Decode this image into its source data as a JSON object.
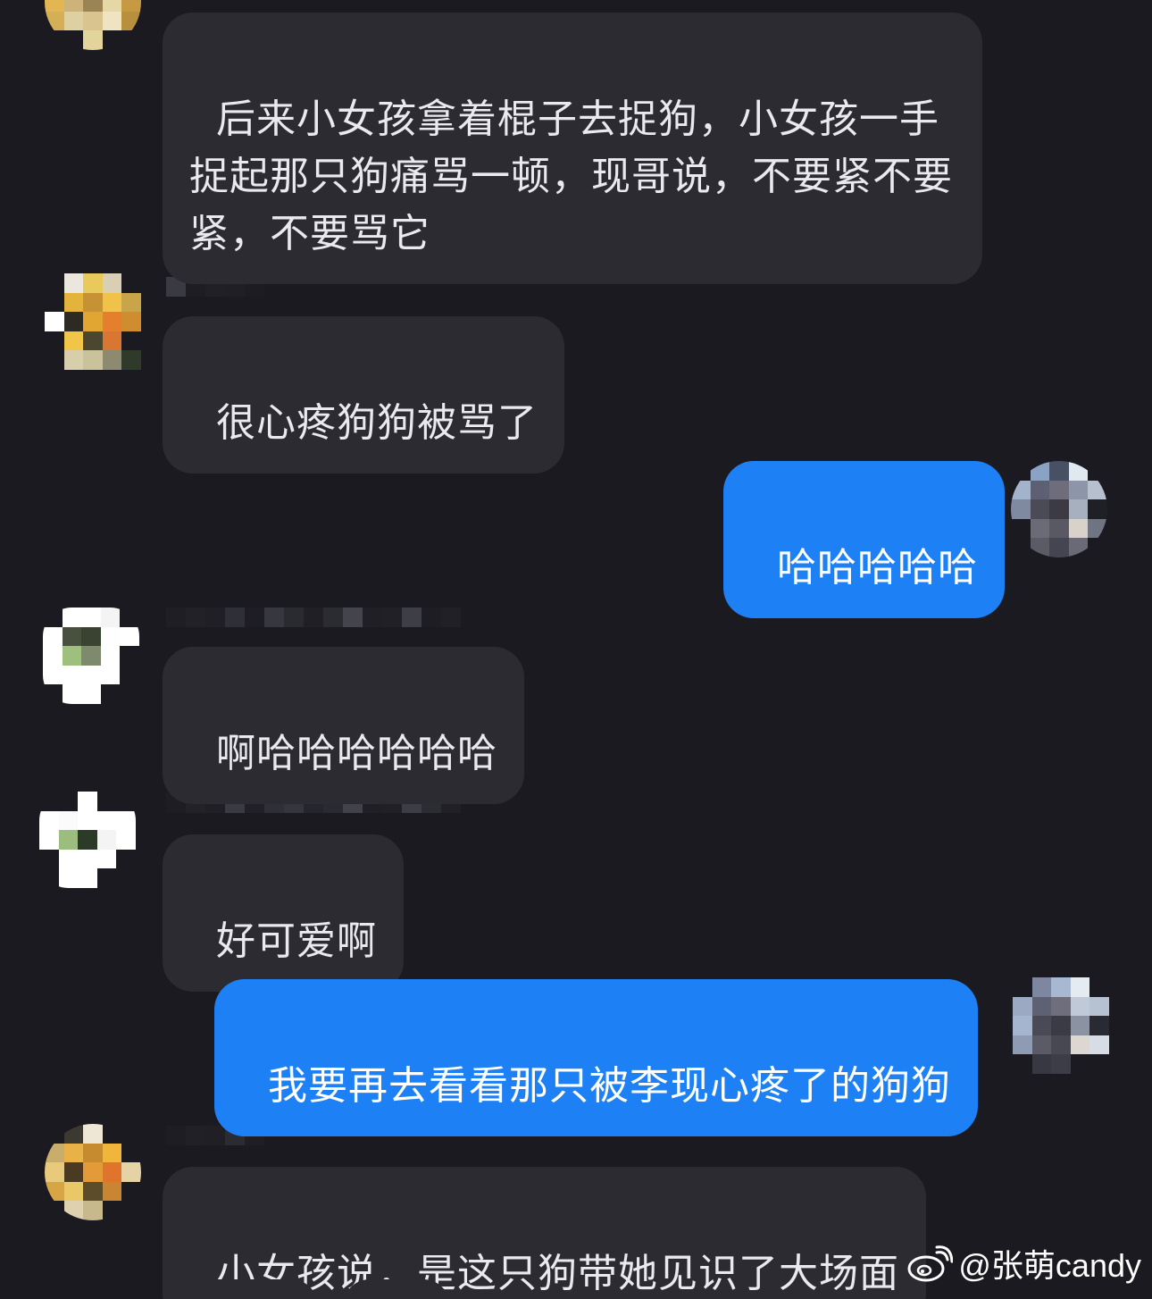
{
  "messages": [
    {
      "side": "in",
      "text": "后来小女孩拿着棍子去捉狗，小女孩一手捉起那只狗痛骂一顿，现哥说，不要紧不要紧，不要骂它"
    },
    {
      "side": "in",
      "text": "很心疼狗狗被骂了"
    },
    {
      "side": "out",
      "text": "哈哈哈哈哈"
    },
    {
      "side": "in",
      "text": "啊哈哈哈哈哈哈"
    },
    {
      "side": "in",
      "text": "好可爱啊"
    },
    {
      "side": "out",
      "text": "我要再去看看那只被李现心疼了的狗狗"
    },
    {
      "side": "in",
      "text": "小女孩说，是这只狗带她见识了大场面"
    }
  ],
  "watermark": {
    "text": "@张萌candy"
  },
  "colors": {
    "background": "#1a1a20",
    "incoming_bubble": "#2b2b31",
    "outgoing_bubble": "#1e80f5"
  }
}
